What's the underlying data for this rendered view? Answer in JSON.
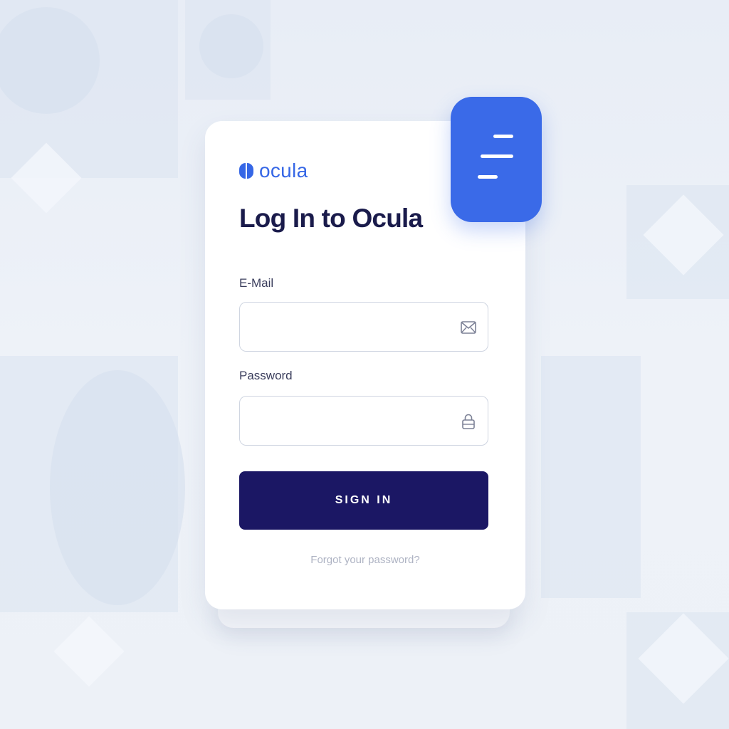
{
  "brand": {
    "name": "ocula",
    "accent_color": "#3667e6"
  },
  "login": {
    "title": "Log In to Ocula",
    "email": {
      "label": "E-Mail",
      "value": "",
      "icon": "mail-icon"
    },
    "password": {
      "label": "Password",
      "value": "",
      "icon": "lock-icon"
    },
    "submit_label": "SIGN IN",
    "submit_color": "#1b1764",
    "forgot_label": "Forgot your password?"
  },
  "menu_button": {
    "icon": "menu-icon",
    "color": "#3a6ae8"
  }
}
